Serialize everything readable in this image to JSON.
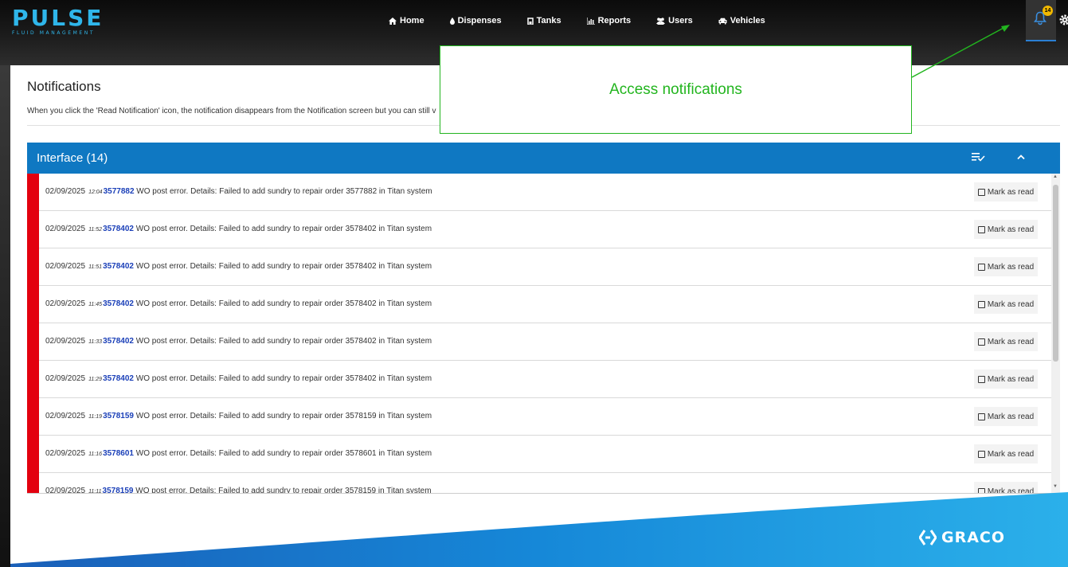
{
  "brand": {
    "name": "PULSE",
    "tagline": "FLUID MANAGEMENT"
  },
  "nav": [
    {
      "label": "Home",
      "icon": "home-icon"
    },
    {
      "label": "Dispenses",
      "icon": "drop-icon"
    },
    {
      "label": "Tanks",
      "icon": "tank-icon"
    },
    {
      "label": "Reports",
      "icon": "bar-chart-icon"
    },
    {
      "label": "Users",
      "icon": "users-icon"
    },
    {
      "label": "Vehicles",
      "icon": "car-icon"
    }
  ],
  "header": {
    "notification_count": "14"
  },
  "page": {
    "title": "Notifications",
    "description": "When you click the 'Read Notification' icon, the notification disappears from the Notification screen but you can still v"
  },
  "panel": {
    "title": "Interface (14)"
  },
  "notifications": [
    {
      "date": "02/09/2025",
      "time": "12:04",
      "id": "3577882",
      "message": " WO post error. Details: Failed to add sundry to repair order 3577882 in Titan system",
      "action": "Mark as read"
    },
    {
      "date": "02/09/2025",
      "time": "11:52",
      "id": "3578402",
      "message": " WO post error. Details: Failed to add sundry to repair order 3578402 in Titan system",
      "action": "Mark as read"
    },
    {
      "date": "02/09/2025",
      "time": "11:51",
      "id": "3578402",
      "message": " WO post error. Details: Failed to add sundry to repair order 3578402 in Titan system",
      "action": "Mark as read"
    },
    {
      "date": "02/09/2025",
      "time": "11:45",
      "id": "3578402",
      "message": " WO post error. Details: Failed to add sundry to repair order 3578402 in Titan system",
      "action": "Mark as read"
    },
    {
      "date": "02/09/2025",
      "time": "11:33",
      "id": "3578402",
      "message": " WO post error. Details: Failed to add sundry to repair order 3578402 in Titan system",
      "action": "Mark as read"
    },
    {
      "date": "02/09/2025",
      "time": "11:29",
      "id": "3578402",
      "message": " WO post error. Details: Failed to add sundry to repair order 3578402 in Titan system",
      "action": "Mark as read"
    },
    {
      "date": "02/09/2025",
      "time": "11:19",
      "id": "3578159",
      "message": " WO post error. Details: Failed to add sundry to repair order 3578159 in Titan system",
      "action": "Mark as read"
    },
    {
      "date": "02/09/2025",
      "time": "11:16",
      "id": "3578601",
      "message": " WO post error. Details: Failed to add sundry to repair order 3578601 in Titan system",
      "action": "Mark as read"
    },
    {
      "date": "02/09/2025",
      "time": "11:11",
      "id": "3578159",
      "message": " WO post error. Details: Failed to add sundry to repair order 3578159 in Titan system",
      "action": "Mark as read"
    }
  ],
  "callout": {
    "text": "Access notifications"
  },
  "footer": {
    "brand": "GRACO"
  },
  "colors": {
    "accent_blue": "#0f78c2",
    "logo_blue": "#2fb6ea",
    "alert_red": "#e3000f",
    "callout_green": "#23b51f",
    "badge_yellow": "#f0b800",
    "link_blue": "#1a3fb8"
  }
}
